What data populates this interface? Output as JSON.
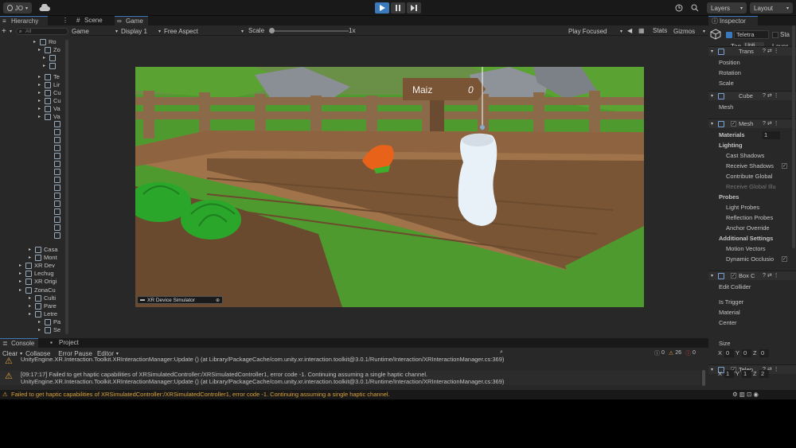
{
  "toolbar": {
    "account_label": "JO",
    "layers_label": "Layers",
    "layout_label": "Layout"
  },
  "hierarchy": {
    "tab_label": "Hierarchy",
    "search_placeholder": "All",
    "items": [
      {
        "label": "Ro"
      },
      {
        "label": "Zo"
      },
      {
        "label": ""
      },
      {
        "label": ""
      },
      {
        "label": "Te"
      },
      {
        "label": "Lir"
      },
      {
        "label": "Cu"
      },
      {
        "label": "Cu"
      },
      {
        "label": "Va"
      },
      {
        "label": "Va"
      },
      {
        "label": "Casa"
      },
      {
        "label": "Mont"
      },
      {
        "label": "XR Dev"
      },
      {
        "label": "Lechug"
      },
      {
        "label": "XR Origi"
      },
      {
        "label": "ZonaCu"
      },
      {
        "label": "Culti"
      },
      {
        "label": "Pare"
      },
      {
        "label": "Letre"
      },
      {
        "label": "Pa"
      },
      {
        "label": "Se"
      }
    ]
  },
  "game_tabs": {
    "scene_label": "Scene",
    "game_label": "Game"
  },
  "game_bar": {
    "mode": "Game",
    "display": "Display 1",
    "aspect": "Free Aspect",
    "scale_label": "Scale",
    "scale_value": "1x",
    "play_focused": "Play Focused",
    "stats": "Stats",
    "gizmos": "Gizmos"
  },
  "scene": {
    "sign_label": "Maiz",
    "sign_count": "0",
    "simulator_label": "XR Device Simulator"
  },
  "inspector": {
    "tab_label": "Inspector",
    "object_name": "Teletra",
    "static_label": "Sta",
    "tag_label": "Tag",
    "tag_value": "Unti",
    "layer_label": "Layer",
    "transform_label": "Trans",
    "position_label": "Position",
    "rotation_label": "Rotation",
    "scale_label": "Scale",
    "cube_label": "Cube",
    "mesh_label": "Mesh",
    "mesh_renderer_label": "Mesh",
    "materials_label": "Materials",
    "materials_count": "1",
    "lighting_label": "Lighting",
    "cast_shadows": "Cast Shadows",
    "receive_shadows": "Receive Shadows",
    "contribute_global": "Contribute Global",
    "receive_global": "Receive Global Illu",
    "probes_label": "Probes",
    "light_probes": "Light Probes",
    "reflection_probes": "Reflection Probes",
    "anchor_override": "Anchor Override",
    "additional_label": "Additional Settings",
    "motion_vectors": "Motion Vectors",
    "dynamic_occlusion": "Dynamic Occlusio",
    "box_collider_label": "Box C",
    "edit_collider": "Edit Collider",
    "is_trigger": "Is Trigger",
    "material_label": "Material",
    "center_label": "Center",
    "center_x": "0",
    "center_y": "0",
    "center_z": "0",
    "size_label": "Size",
    "size_x": "1",
    "size_y": "1",
    "size_z": "2",
    "telep_label": "Telep",
    "axis_x": "X",
    "axis_y": "Y",
    "axis_z": "Z"
  },
  "console": {
    "console_tab": "Console",
    "project_tab": "Project",
    "clear_label": "Clear",
    "collapse_label": "Collapse",
    "error_pause_label": "Error Pause",
    "editor_label": "Editor",
    "count_info": "0",
    "count_warn": "26",
    "count_err": "0",
    "logs": [
      {
        "line1": "",
        "line2": "UnityEngine.XR.Interaction.Toolkit.XRInteractionManager:Update () (at Library/PackageCache/com.unity.xr.interaction.toolkit@3.0.1/Runtime/Interaction/XRInteractionManager.cs:369)"
      },
      {
        "line1": "[09:17:17] Failed to get haptic capabilities of XRSimulatedController:/XRSimulatedController1, error code -1. Continuing assuming a single haptic channel.",
        "line2": "UnityEngine.XR.Interaction.Toolkit.XRInteractionManager:Update () (at Library/PackageCache/com.unity.xr.interaction.toolkit@3.0.1/Runtime/Interaction/XRInteractionManager.cs:369)"
      }
    ]
  },
  "status": {
    "message": "Failed to get haptic capabilities of XRSimulatedController:/XRSimulatedController1, error code -1. Continuing assuming a single haptic channel."
  },
  "colors": {
    "accent": "#3a79bb",
    "warning": "#d8a23a",
    "grass": "#4f9a2e",
    "wood": "#7a5535",
    "sky": "#5b6a5a"
  }
}
